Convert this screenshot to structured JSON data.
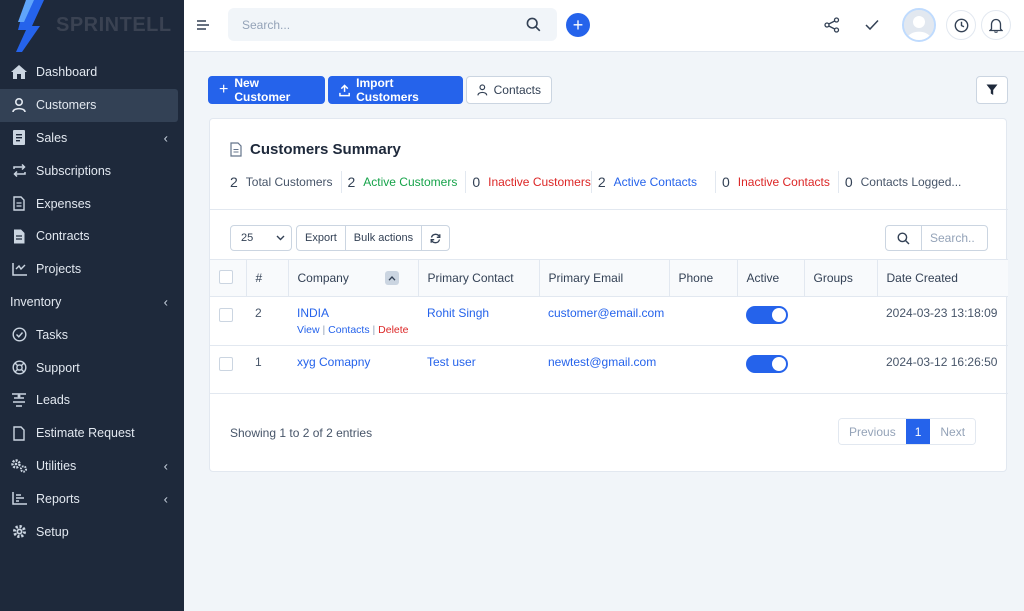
{
  "brand": {
    "name": "SPRINTELL"
  },
  "sidebar": {
    "items": [
      {
        "label": "Dashboard",
        "icon": "home-icon"
      },
      {
        "label": "Customers",
        "icon": "user-icon",
        "active": true
      },
      {
        "label": "Sales",
        "icon": "receipt-icon",
        "has_children": true
      },
      {
        "label": "Subscriptions",
        "icon": "repeat-icon"
      },
      {
        "label": "Expenses",
        "icon": "file-icon"
      },
      {
        "label": "Contracts",
        "icon": "contract-icon"
      },
      {
        "label": "Projects",
        "icon": "chart-icon"
      },
      {
        "label": "Inventory",
        "icon": "",
        "has_children": true
      },
      {
        "label": "Tasks",
        "icon": "check-circle-icon"
      },
      {
        "label": "Support",
        "icon": "lifebuoy-icon"
      },
      {
        "label": "Leads",
        "icon": "funnel-icon"
      },
      {
        "label": "Estimate Request",
        "icon": "file-icon"
      },
      {
        "label": "Utilities",
        "icon": "cogs-icon",
        "has_children": true
      },
      {
        "label": "Reports",
        "icon": "bar-chart-icon",
        "has_children": true
      },
      {
        "label": "Setup",
        "icon": "gear-icon"
      }
    ]
  },
  "topbar": {
    "search_placeholder": "Search..."
  },
  "actions": {
    "new_customer": "New Customer",
    "import_customers": "Import Customers",
    "contacts": "Contacts"
  },
  "summary": {
    "title": "Customers Summary",
    "stats": [
      {
        "num": "2",
        "label": "Total Customers",
        "tone": "default"
      },
      {
        "num": "2",
        "label": "Active Customers",
        "tone": "green"
      },
      {
        "num": "0",
        "label": "Inactive Customers",
        "tone": "red"
      },
      {
        "num": "2",
        "label": "Active Contacts",
        "tone": "blue"
      },
      {
        "num": "0",
        "label": "Inactive Contacts",
        "tone": "red"
      },
      {
        "num": "0",
        "label": "Contacts Logged...",
        "tone": "default"
      }
    ]
  },
  "table_tools": {
    "page_length": "25",
    "export": "Export",
    "bulk_actions": "Bulk actions",
    "search_placeholder": "Search.."
  },
  "table": {
    "columns": [
      "#",
      "Company",
      "Primary Contact",
      "Primary Email",
      "Phone",
      "Active",
      "Groups",
      "Date Created"
    ],
    "rows": [
      {
        "id": "2",
        "company": "INDIA",
        "contact": "Rohit Singh",
        "email": "customer@email.com",
        "phone": "",
        "active": true,
        "groups": "",
        "date": "2024-03-23 13:18:09",
        "actions": {
          "view": "View",
          "contacts": "Contacts",
          "delete": "Delete"
        }
      },
      {
        "id": "1",
        "company": "xyg Comapny",
        "contact": "Test user",
        "email": "newtest@gmail.com",
        "phone": "",
        "active": true,
        "groups": "",
        "date": "2024-03-12 16:26:50"
      }
    ]
  },
  "footer": {
    "showing": "Showing 1 to 2 of 2 entries",
    "previous": "Previous",
    "current_page": "1",
    "next": "Next"
  },
  "colors": {
    "primary": "#2563eb",
    "sidebar_bg": "#1e293b",
    "green": "#16a34a",
    "red": "#dc2626"
  }
}
